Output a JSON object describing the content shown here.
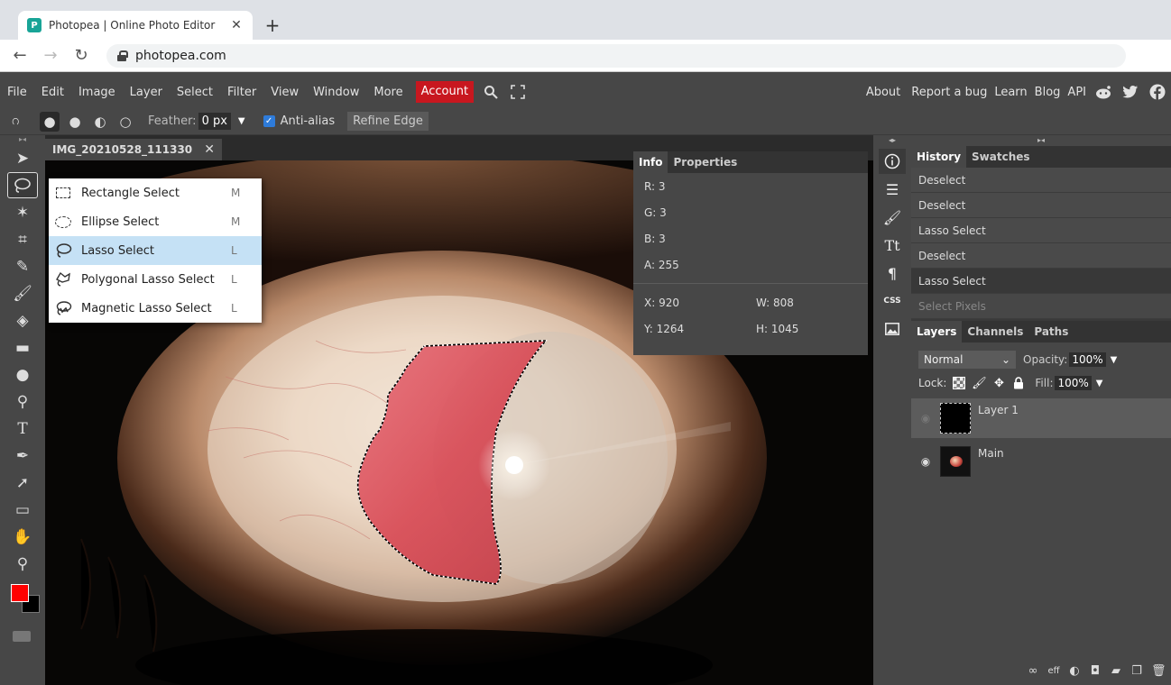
{
  "browser": {
    "tab_title": "Photopea | Online Photo Editor",
    "tab_close": "✕",
    "new_tab": "+",
    "url": "photopea.com"
  },
  "menu": {
    "items": [
      "File",
      "Edit",
      "Image",
      "Layer",
      "Select",
      "Filter",
      "View",
      "Window",
      "More"
    ],
    "account": "Account",
    "right_items": [
      "About",
      "Report a bug",
      "Learn",
      "Blog",
      "API"
    ]
  },
  "options": {
    "feather_label": "Feather:",
    "feather_value": "0 px",
    "antialias_label": "Anti-alias",
    "refine_edge": "Refine Edge"
  },
  "document": {
    "tab_name": "IMG_20210528_111330",
    "tab_close": "✕"
  },
  "flyout": [
    {
      "label": "Rectangle Select",
      "key": "M"
    },
    {
      "label": "Ellipse Select",
      "key": "M"
    },
    {
      "label": "Lasso Select",
      "key": "L"
    },
    {
      "label": "Polygonal Lasso Select",
      "key": "L"
    },
    {
      "label": "Magnetic Lasso Select",
      "key": "L"
    }
  ],
  "info_panel": {
    "tabs": [
      "Info",
      "Properties"
    ],
    "r": "R: 3",
    "g": "G: 3",
    "b": "B: 3",
    "a": "A: 255",
    "x": "X: 920",
    "y": "Y: 1264",
    "w": "W: 808",
    "h": "H: 1045"
  },
  "history_panel": {
    "tabs": [
      "History",
      "Swatches"
    ],
    "items": [
      "Deselect",
      "Deselect",
      "Lasso Select",
      "Deselect",
      "Lasso Select",
      "Select Pixels"
    ]
  },
  "layers_panel": {
    "tabs": [
      "Layers",
      "Channels",
      "Paths"
    ],
    "blend_mode": "Normal",
    "opacity_label": "Opacity:",
    "opacity_value": "100%",
    "lock_label": "Lock:",
    "fill_label": "Fill:",
    "fill_value": "100%",
    "layers": [
      "Layer 1",
      "Main"
    ]
  },
  "icon_column_text": {
    "css": "CSS",
    "text_icon": "Tt",
    "paragraph": "¶"
  },
  "colors": {
    "foreground": "#ff0000",
    "background": "#000000",
    "account_red": "#c8171f",
    "ui_gray": "#474747",
    "selection_highlight": "#c5e1f5"
  }
}
